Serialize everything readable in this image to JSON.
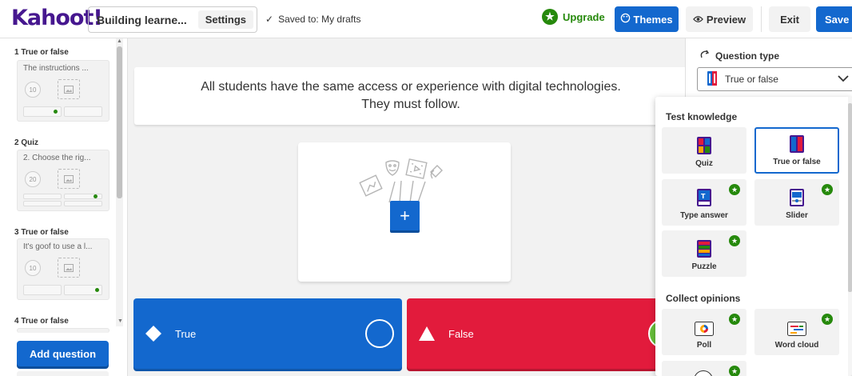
{
  "header": {
    "logo": "Kahoot!",
    "title": "Building learne...",
    "settings_label": "Settings",
    "saved_text": "Saved to: My drafts",
    "upgrade_label": "Upgrade",
    "themes_label": "Themes",
    "preview_label": "Preview",
    "exit_label": "Exit",
    "save_label": "Save"
  },
  "sidebar": {
    "slides": [
      {
        "label": "1 True or false",
        "preview": "The instructions ...",
        "timer": "10",
        "correct": "right"
      },
      {
        "label": "2 Quiz",
        "preview": "2. Choose the rig...",
        "timer": "20",
        "correct": "right"
      },
      {
        "label": "3 True or false",
        "preview": "It's goof to use a l...",
        "timer": "10",
        "correct": "right"
      },
      {
        "label": "4 True or false",
        "preview": "",
        "timer": "",
        "correct": ""
      }
    ],
    "add_question_label": "Add question"
  },
  "editor": {
    "question_line1": "All students have the same access or experience with digital technologies.",
    "question_line2": "They must follow.",
    "answers": [
      {
        "label": "True",
        "color": "#1368ce",
        "shape": "diamond",
        "marked_correct": false
      },
      {
        "label": "False",
        "color": "#e21b3c",
        "shape": "triangle",
        "marked_correct": true
      }
    ]
  },
  "right_panel": {
    "question_type_heading": "Question type",
    "selected_type": "True or false"
  },
  "dropdown": {
    "section_test": "Test knowledge",
    "section_opinions": "Collect opinions",
    "test_types": [
      {
        "name": "Quiz",
        "pro": false,
        "selected": false
      },
      {
        "name": "True or false",
        "pro": false,
        "selected": true
      },
      {
        "name": "Type answer",
        "pro": true,
        "selected": false
      },
      {
        "name": "Slider",
        "pro": true,
        "selected": false
      },
      {
        "name": "Puzzle",
        "pro": true,
        "selected": false
      }
    ],
    "opinion_types": [
      {
        "name": "Poll",
        "pro": true
      },
      {
        "name": "Word cloud",
        "pro": true
      }
    ]
  },
  "colors": {
    "brand": "#46178f",
    "primary": "#1368ce",
    "upgrade_green": "#26890c",
    "answer_red": "#e21b3c",
    "correct_green": "#66bf39"
  }
}
